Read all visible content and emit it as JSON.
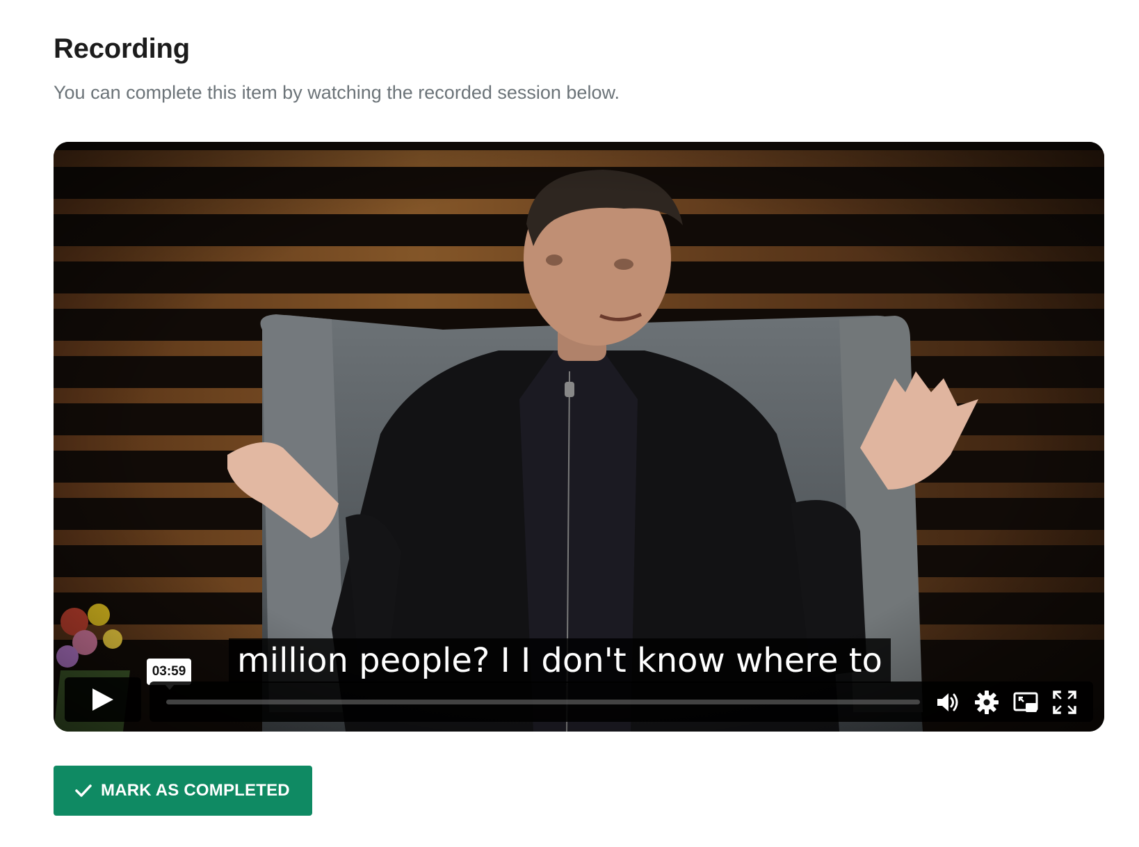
{
  "page": {
    "title": "Recording",
    "subtitle": "You can complete this item by watching the recorded session below."
  },
  "player": {
    "caption": "million people? I I don't know where to",
    "hover_time": "03:59",
    "progress_fraction": 0.0,
    "controls": {
      "play_icon": "play-icon",
      "volume_icon": "volume-icon",
      "settings_icon": "gear-icon",
      "pip_icon": "picture-in-picture-icon",
      "fullscreen_icon": "fullscreen-icon"
    }
  },
  "actions": {
    "mark_completed_label": "MARK AS COMPLETED",
    "mark_completed_icon": "check-icon",
    "accent_color": "#0f8a63"
  }
}
